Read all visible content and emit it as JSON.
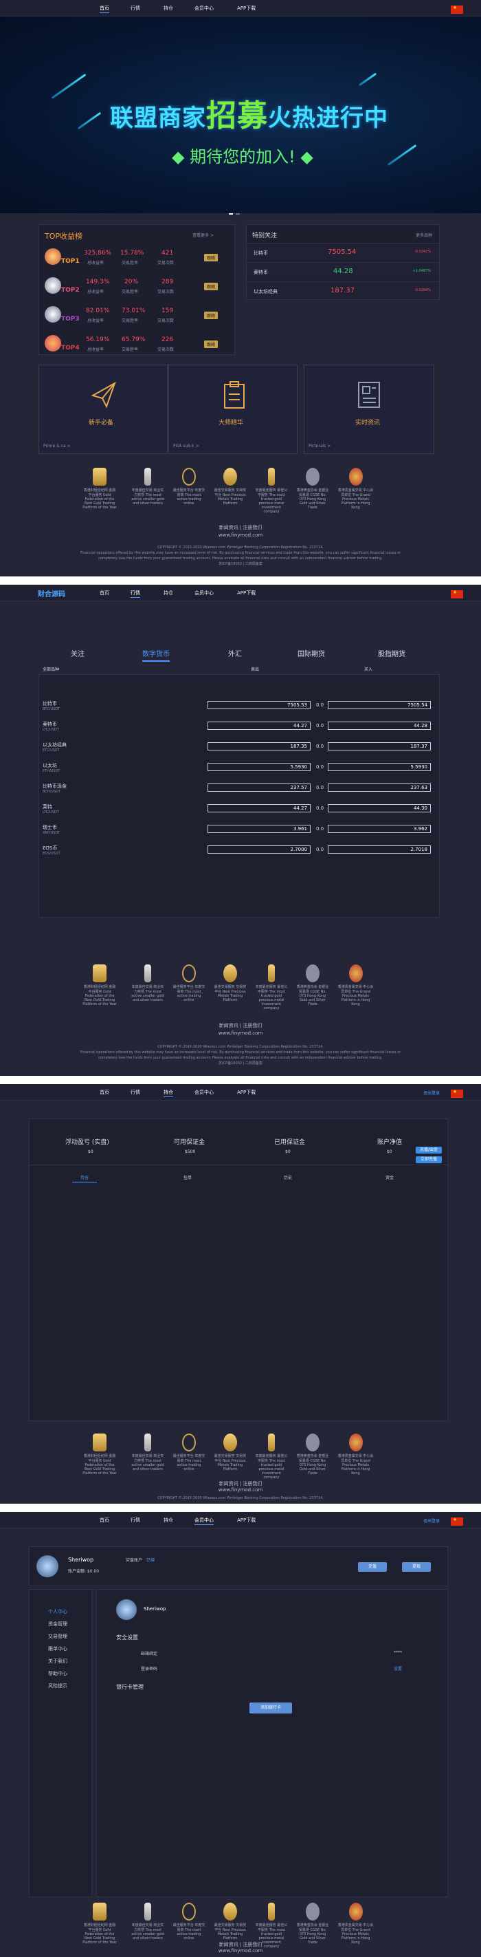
{
  "nav": {
    "items": [
      "首页",
      "行情",
      "持仓",
      "会员中心",
      "APP下载"
    ],
    "logo_text": "财合源码",
    "login_link": "退出登录"
  },
  "banner": {
    "title_pre": "联盟商家",
    "title_big": "招募",
    "title_post": "火热进行中",
    "subtitle": "期待您的加入!"
  },
  "top_profit": {
    "title": "TOP收益榜",
    "more": "查看更多 >",
    "rows": [
      {
        "rank": "TOP1",
        "name": "",
        "pct": "325.86%",
        "pct_label": "总收益率",
        "win": "15.78%",
        "win_label": "交易胜率",
        "count": "421",
        "count_label": "交易次数",
        "follow": "跟随"
      },
      {
        "rank": "TOP2",
        "name": "张…",
        "pct": "149.3%",
        "pct_label": "总收益率",
        "win": "20%",
        "win_label": "交易胜率",
        "count": "289",
        "count_label": "交易次数",
        "follow": "跟随"
      },
      {
        "rank": "TOP3",
        "name": "…",
        "pct": "82.01%",
        "pct_label": "总收益率",
        "win": "73.01%",
        "win_label": "交易胜率",
        "count": "159",
        "count_label": "交易次数",
        "follow": "跟随"
      },
      {
        "rank": "TOP4",
        "name": "…",
        "pct": "56.19%",
        "pct_label": "总收益率",
        "win": "65.79%",
        "win_label": "交易胜率",
        "count": "226",
        "count_label": "交易次数",
        "follow": "跟随"
      }
    ]
  },
  "special": {
    "title": "特别关注",
    "more": "更多品种",
    "rows": [
      {
        "name": "比特币",
        "price": "7505.54",
        "change": "-0.0242%"
      },
      {
        "name": "莱特币",
        "price": "44.28",
        "change": "+1.0487%"
      },
      {
        "name": "以太坊经典",
        "price": "187.37",
        "change": "-0.0284%"
      }
    ]
  },
  "features": [
    {
      "label": "新手必备",
      "sub": "Prime & ca >"
    },
    {
      "label": "大师精华",
      "sub": "PGA sub-k >"
    },
    {
      "label": "实时资讯",
      "sub": "Pictorals >"
    }
  ],
  "awards": [
    {
      "text": "香港财经经纪网 金融平台服务 Gold Federation of the Best Gold Trading Platform of the Year"
    },
    {
      "text": "年度最佳交易 商业实力奖项 The most active smaller gold and silver traders"
    },
    {
      "text": "最佳服务平台 年度交易商 The most active trading online"
    },
    {
      "text": "最佳交易服务 交易奖平台 Best Precious Metals Trading Platform"
    },
    {
      "text": "年度最佳服务 最佳公平服务 The most trusted gold precious metal investment company"
    },
    {
      "text": "香港黄金协会 金银业贸易场 CGSE No. 073 Hong Kong Gold and Silver Trade"
    },
    {
      "text": "香港贵金属交易 中心会员单位 The Grand Precious Metals Platform in Hong Kong"
    }
  ],
  "footer": {
    "links": "新闻资讯 | 注册我们",
    "site": "www.finymod.com",
    "copyright": "COPYRIGHT © 2015-2020 Wlasous.com Wmlelger Banking Corporation Registration No. 233714.",
    "risk1": "Financial operations offered by this website may have an increased level of risk. By purchasing financial services and trade from this website, you can suffer significant financial losses or",
    "risk2": "completely lose the funds from your guaranteed trading account. Please evaluate all financial risks and consult with an independent financial advisor before trading.",
    "icp": "苏ICP备18002 | 工商局备案"
  },
  "market": {
    "tabs": [
      "关注",
      "数字货币",
      "外汇",
      "国际期货",
      "股指期货"
    ],
    "active_tab": 1,
    "col_name": "全部品种",
    "col_bid": "卖出",
    "col_ask": "买入",
    "rows": [
      {
        "name": "比特币",
        "code": "BTC/USDT",
        "bid": "7505.53",
        "spread": "0.0",
        "ask": "7505.54"
      },
      {
        "name": "莱特币",
        "code": "LTC/USDT",
        "bid": "44.27",
        "spread": "0.0",
        "ask": "44.28"
      },
      {
        "name": "以太坊经典",
        "code": "ETC/USDT",
        "bid": "187.35",
        "spread": "0.0",
        "ask": "187.37"
      },
      {
        "name": "以太坊",
        "code": "ETH/USDT",
        "bid": "5.5930",
        "spread": "0.0",
        "ask": "5.5930"
      },
      {
        "name": "比特币现金",
        "code": "BCH/USDT",
        "bid": "237.57",
        "spread": "0.0",
        "ask": "237.63"
      },
      {
        "name": "莱特",
        "code": "LTC/USDT",
        "bid": "44.27",
        "spread": "0.0",
        "ask": "44.30"
      },
      {
        "name": "瑞士币",
        "code": "XRP/USDT",
        "bid": "3.961",
        "spread": "0.0",
        "ask": "3.962"
      },
      {
        "name": "EOS币",
        "code": "EOS/USDT",
        "bid": "2.7000",
        "spread": "0.0",
        "ask": "2.7018"
      }
    ]
  },
  "positions": {
    "stats": [
      {
        "label": "浮动盈亏 (实盘)",
        "value": "$0"
      },
      {
        "label": "可用保证金",
        "value": "$500"
      },
      {
        "label": "已用保证金",
        "value": "$0"
      },
      {
        "label": "账户净值",
        "value": "$0"
      }
    ],
    "buttons": [
      "充值/出金",
      "立即充值"
    ],
    "tabs": [
      "持仓",
      "挂单",
      "历史",
      "资金"
    ]
  },
  "member": {
    "username": "Sheriwop",
    "real_name_label": "实盘账户",
    "real_name_status": "已绑",
    "balance": "账户金额: $0.00",
    "btn_deposit": "充值",
    "btn_withdraw": "提现",
    "menu": [
      "个人中心",
      "资金管理",
      "交易管理",
      "跟单中心",
      "关于我们",
      "帮助中心",
      "风险提示"
    ],
    "profile_name": "Sheriwop",
    "security_title": "安全设置",
    "security_rows": [
      {
        "label": "邮箱绑定",
        "value": "****"
      },
      {
        "label": "登录密码",
        "value": "设置"
      }
    ],
    "bank_title": "银行卡管理",
    "bind_button": "添加银行卡"
  }
}
